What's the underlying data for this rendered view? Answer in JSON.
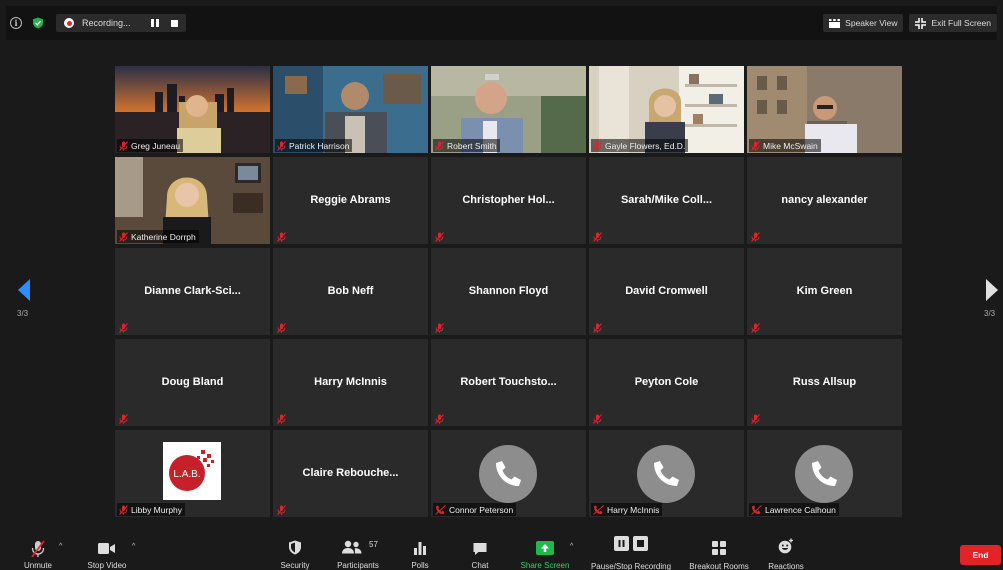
{
  "top_bar": {
    "recording_label": "Recording...",
    "speaker_view_label": "Speaker View",
    "exit_full_screen_label": "Exit Full Screen"
  },
  "navigation": {
    "left_page": "3/3",
    "right_page": "3/3"
  },
  "participants": [
    {
      "name": "Greg Juneau",
      "type": "video",
      "scene": "city-sunset"
    },
    {
      "name": "Patrick Harrison",
      "type": "video",
      "scene": "office-blue"
    },
    {
      "name": "Robert Smith",
      "type": "video",
      "scene": "office-green"
    },
    {
      "name": "Gayle Flowers, Ed.D.",
      "type": "video",
      "scene": "bookshelf"
    },
    {
      "name": "Mike McSwain",
      "type": "video",
      "scene": "street"
    },
    {
      "name": "Katherine Dorrph",
      "type": "video",
      "scene": "home-office"
    },
    {
      "name": "Reggie Abrams",
      "type": "name"
    },
    {
      "name": "Christopher  Hol...",
      "type": "name"
    },
    {
      "name": "Sarah/Mike  Coll...",
      "type": "name"
    },
    {
      "name": "nancy alexander",
      "type": "name"
    },
    {
      "name": "Dianne  Clark-Sci...",
      "type": "name"
    },
    {
      "name": "Bob Neff",
      "type": "name"
    },
    {
      "name": "Shannon Floyd",
      "type": "name"
    },
    {
      "name": "David Cromwell",
      "type": "name"
    },
    {
      "name": "Kim Green",
      "type": "name"
    },
    {
      "name": "Doug Bland",
      "type": "name"
    },
    {
      "name": "Harry McInnis",
      "type": "name"
    },
    {
      "name": "Robert  Touchsto...",
      "type": "name"
    },
    {
      "name": "Peyton Cole",
      "type": "name"
    },
    {
      "name": "Russ Allsup",
      "type": "name"
    },
    {
      "name": "Libby Murphy",
      "type": "logo",
      "logo_text": "L.A.B."
    },
    {
      "name": "Claire  Rebouche...",
      "type": "name"
    },
    {
      "name": "Connor Peterson",
      "type": "phone"
    },
    {
      "name": "Harry McInnis",
      "type": "phone"
    },
    {
      "name": "Lawrence Calhoun",
      "type": "phone"
    }
  ],
  "toolbar": {
    "unmute": "Unmute",
    "stop_video": "Stop Video",
    "security": "Security",
    "participants": "Participants",
    "participants_count": "57",
    "polls": "Polls",
    "chat": "Chat",
    "share_screen": "Share Screen",
    "pause_stop_recording": "Pause/Stop Recording",
    "breakout_rooms": "Breakout Rooms",
    "reactions": "Reactions",
    "end": "End"
  },
  "colors": {
    "background": "#1a1a1a",
    "tile": "#2a2a2a",
    "muted_mic": "#e0242a",
    "share_green": "#1fb84a",
    "nav_blue": "#2d8cff",
    "end_red": "#e0242a"
  }
}
